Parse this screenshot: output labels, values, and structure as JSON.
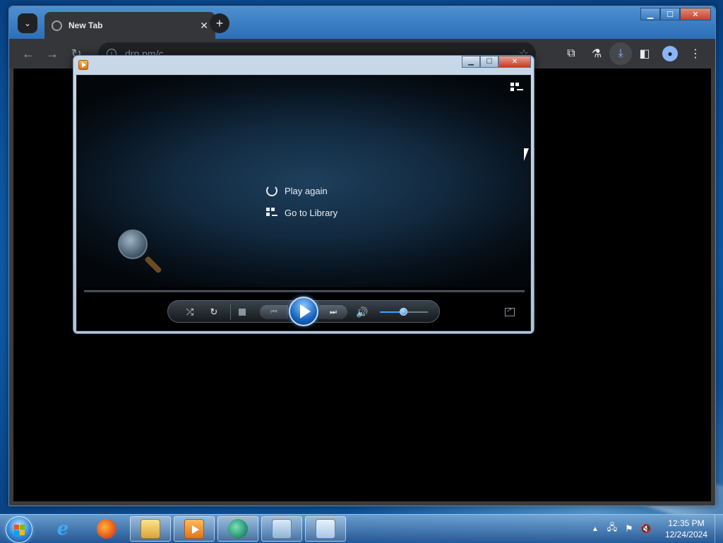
{
  "colors": {
    "chrome_bg": "#35363a",
    "wmp_accent": "#1565c0",
    "taskbar": "#2c6fb8"
  },
  "browser": {
    "tab_search_icon": "chevron-down-icon",
    "tabs": [
      {
        "title": "New Tab",
        "icon": "globe-icon",
        "close": "✕"
      }
    ],
    "new_tab_label": "+",
    "window_controls": {
      "minimize": "▁",
      "maximize": "☐",
      "close": "✕"
    },
    "nav": {
      "back": "←",
      "forward": "→",
      "reload": "↻"
    },
    "address_bar": {
      "value": "drp.pm/c"
    },
    "toolbar_icons": [
      "extensions-icon",
      "labs-icon",
      "download-icon",
      "side-panel-icon",
      "profile-icon",
      "menu-icon"
    ]
  },
  "media_player": {
    "window_controls": {
      "minimize": "▁",
      "maximize": "☐",
      "close": "✕"
    },
    "menu": [
      {
        "label": "Play again",
        "icon": "replay-icon"
      },
      {
        "label": "Go to Library",
        "icon": "library-icon"
      }
    ],
    "volume_level": 0.5
  },
  "taskbar": {
    "items": [
      {
        "name": "internet-explorer",
        "active": false
      },
      {
        "name": "firefox",
        "active": false
      },
      {
        "name": "file-explorer",
        "active": true
      },
      {
        "name": "windows-media-player",
        "active": true
      },
      {
        "name": "gbox",
        "active": true
      },
      {
        "name": "control-panel",
        "active": true
      },
      {
        "name": "network-connections",
        "active": true
      }
    ],
    "tray": {
      "show_hidden": "▲",
      "time": "12:35 PM",
      "date": "12/24/2024"
    }
  }
}
